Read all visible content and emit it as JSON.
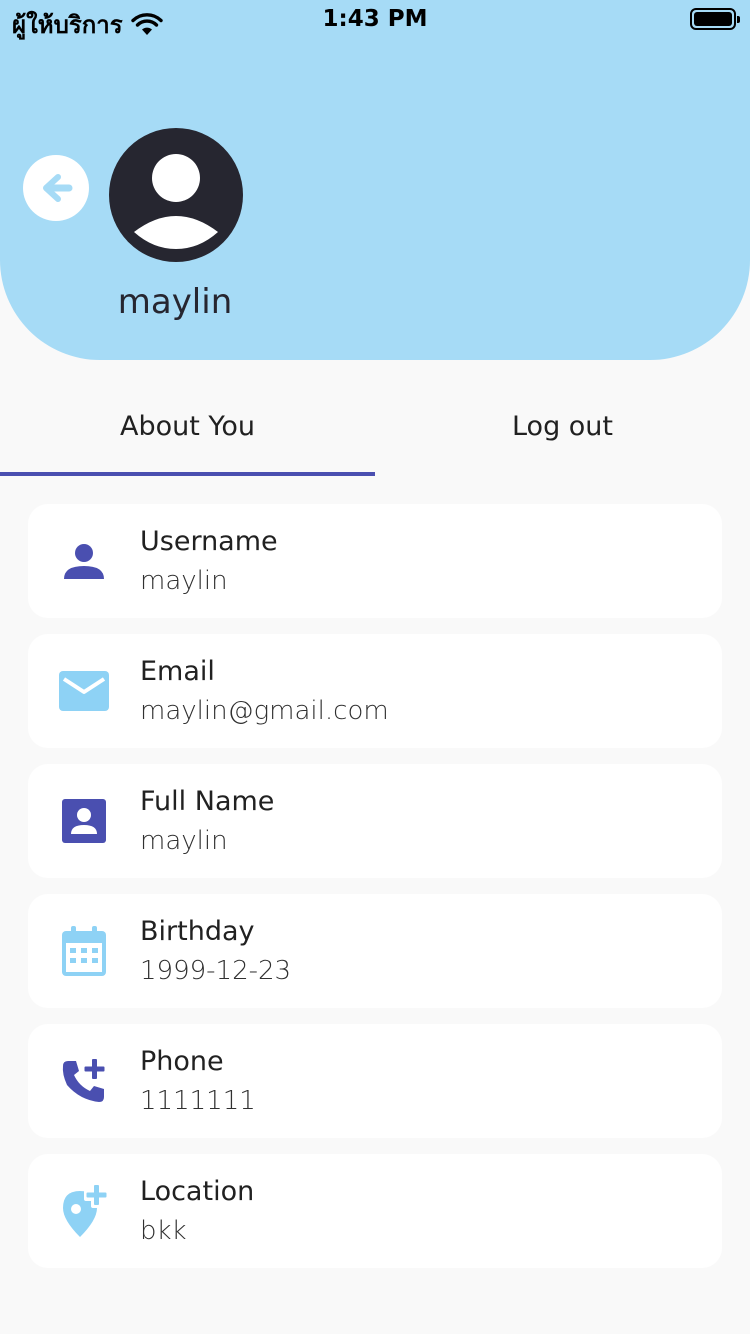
{
  "status_bar": {
    "carrier": "ผู้ให้บริการ",
    "time": "1:43 PM",
    "battery_level": 1.0
  },
  "profile": {
    "name": "maylin",
    "avatar_icon": "account-circle-icon"
  },
  "tabs": [
    {
      "label": "About You",
      "active": true
    },
    {
      "label": "Log out",
      "active": false
    }
  ],
  "fields": [
    {
      "icon": "person-icon",
      "label": "Username",
      "value": "maylin"
    },
    {
      "icon": "mail-icon",
      "label": "Email",
      "value": "maylin@gmail.com"
    },
    {
      "icon": "contact-card-icon",
      "label": "Full Name",
      "value": "maylin"
    },
    {
      "icon": "calendar-icon",
      "label": "Birthday",
      "value": "1999-12-23"
    },
    {
      "icon": "add-call-icon",
      "label": "Phone",
      "value": "1111111"
    },
    {
      "icon": "add-location-icon",
      "label": "Location",
      "value": "bkk"
    }
  ],
  "colors": {
    "header_bg": "#a6dbf6",
    "accent_dark": "#4a4fb0",
    "accent_light": "#8ed2f5",
    "page_bg": "#f9f9f9",
    "avatar": "#262630"
  }
}
